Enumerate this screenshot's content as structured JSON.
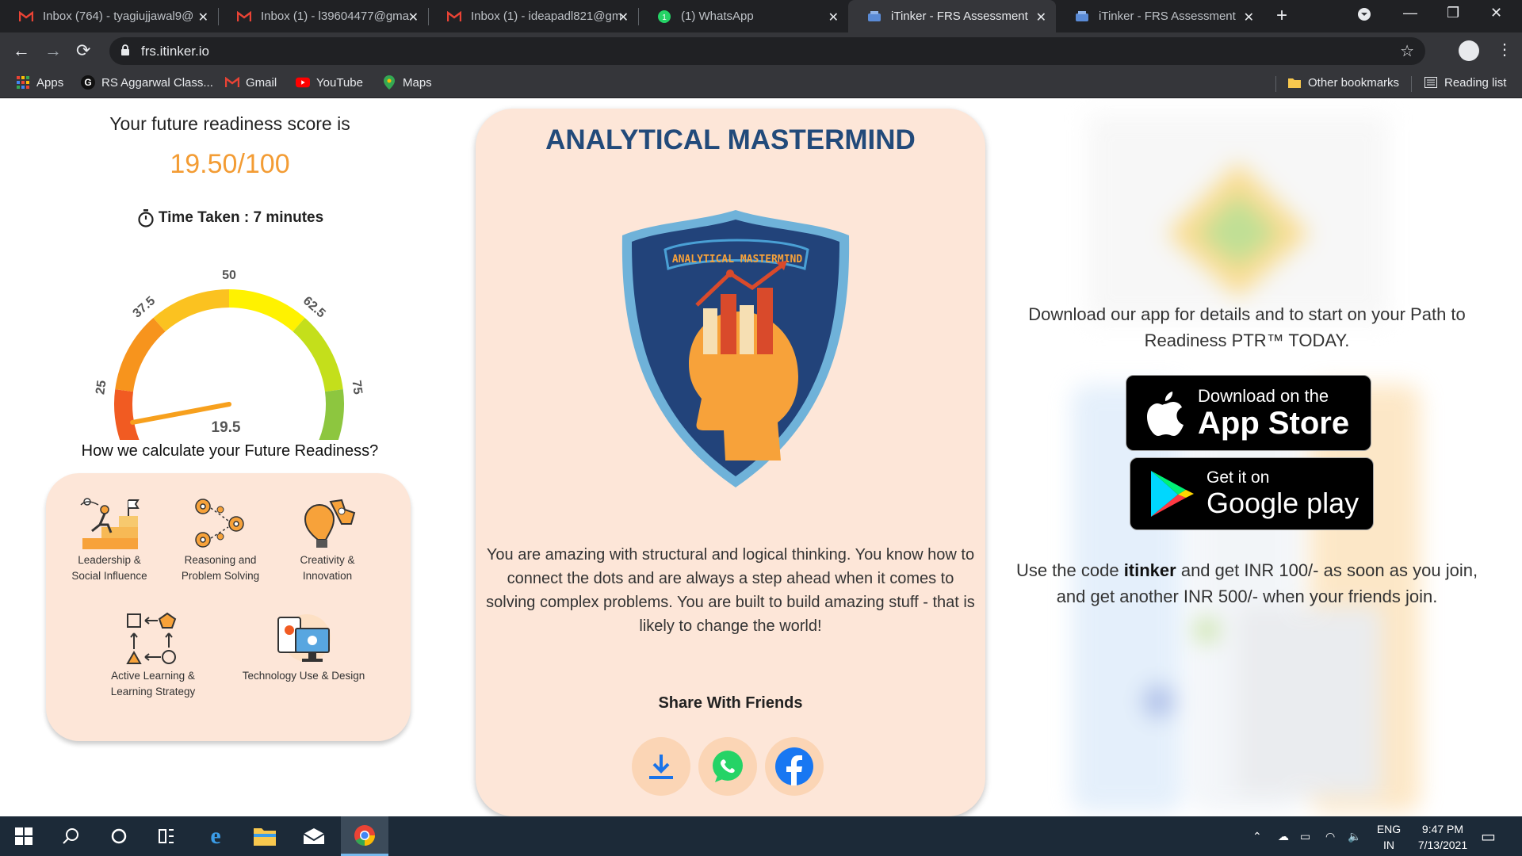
{
  "browser": {
    "tabs": [
      {
        "title": "Inbox (764) - tyagiujjawal9@",
        "favicon": "gmail-icon",
        "active": false
      },
      {
        "title": "Inbox (1) - l39604477@gma",
        "favicon": "gmail-icon",
        "active": false
      },
      {
        "title": "Inbox (1) - ideapadl821@gm",
        "favicon": "gmail-icon",
        "active": false
      },
      {
        "title": "(1) WhatsApp",
        "favicon": "whatsapp-icon",
        "active": false
      },
      {
        "title": "iTinker - FRS Assessment",
        "favicon": "itinker-icon",
        "active": true
      },
      {
        "title": "iTinker - FRS Assessment",
        "favicon": "itinker-icon",
        "active": false
      }
    ],
    "url": "frs.itinker.io",
    "bookmarks": [
      {
        "label": "Apps",
        "icon": "apps-grid-icon"
      },
      {
        "label": "RS Aggarwal Class...",
        "icon": "g-icon"
      },
      {
        "label": "Gmail",
        "icon": "gmail-icon"
      },
      {
        "label": "YouTube",
        "icon": "youtube-icon"
      },
      {
        "label": "Maps",
        "icon": "maps-icon"
      }
    ],
    "other_bookmarks": "Other bookmarks",
    "reading_list": "Reading list"
  },
  "score": {
    "heading": "Your future readiness score is",
    "value": "19.50/100",
    "time_taken": "Time Taken : 7 minutes",
    "gauge": {
      "value": 19.5,
      "value_label": "19.5",
      "min": 0,
      "max": 100,
      "ticks": [
        "0",
        "12.5",
        "25",
        "37.5",
        "50",
        "62.5",
        "75",
        "87.5",
        "100"
      ],
      "colors": [
        "#e52629",
        "#f15b22",
        "#f7941d",
        "#fbc220",
        "#fff200",
        "#c4df1b",
        "#8dc63f",
        "#3ec41c"
      ]
    }
  },
  "calculation": {
    "heading": "How we calculate your Future Readiness?",
    "skills": [
      {
        "label": "Leadership & Social Influence",
        "icon": "leadership-icon"
      },
      {
        "label": "Reasoning and Problem Solving",
        "icon": "gears-icon"
      },
      {
        "label": "Creativity & Innovation",
        "icon": "creativity-icon"
      },
      {
        "label": "Active Learning & Learning Strategy",
        "icon": "learning-cycle-icon"
      },
      {
        "label": "Technology Use & Design",
        "icon": "technology-icon"
      }
    ]
  },
  "persona": {
    "title": "ANALYTICAL MASTERMIND",
    "badge_text": "ANALYTICAL MASTERMIND",
    "description": "You are amazing with structural and logical thinking. You know how to connect the dots and are always a step ahead when it comes to solving complex problems. You are built to build amazing stuff - that is likely to change the world!",
    "share_heading": "Share With Friends",
    "share_buttons": [
      "download-icon",
      "whatsapp-icon",
      "facebook-icon"
    ]
  },
  "app_promo": {
    "download_text": "Download our app for details and to start on your Path to Readiness PTR™ TODAY.",
    "app_store": {
      "small": "Download on the",
      "large": "App Store"
    },
    "google_play": {
      "small": "Get it on",
      "large": "Google play"
    },
    "promo_before": "Use the code ",
    "promo_code": "itinker",
    "promo_after": " and get INR 100/- as soon as you join, and get another INR 500/- when your friends join."
  },
  "taskbar": {
    "lang": "ENG",
    "region": "IN",
    "time": "9:47 PM",
    "date": "7/13/2021"
  }
}
